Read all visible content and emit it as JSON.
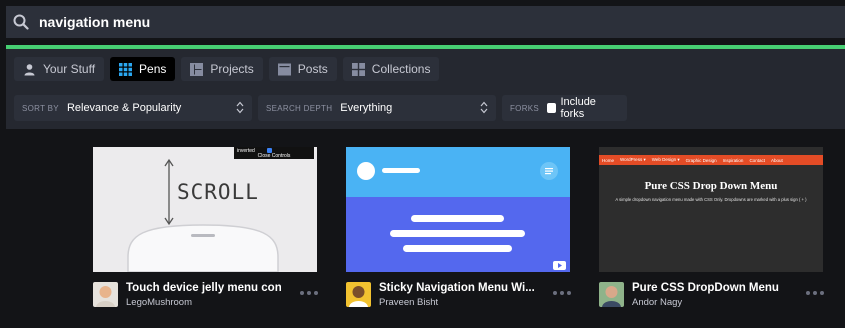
{
  "search": {
    "query": "navigation menu",
    "icon": "search-icon"
  },
  "colors": {
    "accent": "#47cf73",
    "panel": "#252830",
    "control": "#2c303a",
    "page": "#131417"
  },
  "tabs": [
    {
      "label": "Your Stuff",
      "icon": "user-icon",
      "active": false
    },
    {
      "label": "Pens",
      "icon": "pens-grid-icon",
      "active": true
    },
    {
      "label": "Projects",
      "icon": "projects-icon",
      "active": false
    },
    {
      "label": "Posts",
      "icon": "posts-icon",
      "active": false
    },
    {
      "label": "Collections",
      "icon": "collections-icon",
      "active": false
    }
  ],
  "filters": {
    "sort_label": "SORT BY",
    "sort_value": "Relevance & Popularity",
    "depth_label": "SEARCH DEPTH",
    "depth_value": "Everything",
    "forks_label": "FORKS",
    "forks_value": "Include forks"
  },
  "cards": [
    {
      "title": "Touch device jelly menu con...",
      "author": "LegoMushroom",
      "thumb": {
        "scroll_text": "SCROLL",
        "overlay_label": "inverted",
        "close_controls": "Close Controls"
      }
    },
    {
      "title": "Sticky Navigation Menu Wi...",
      "author": "Praveen Bisht"
    },
    {
      "title": "Pure CSS DropDown Menu",
      "author": "Andor Nagy",
      "thumb": {
        "nav_items": [
          "Home",
          "WordPress ▾",
          "Web Design ▾",
          "Graphic Design",
          "Inspiration",
          "Contact",
          "About"
        ],
        "heading": "Pure CSS Drop Down Menu",
        "description": "A simple dropdown navigation menu made with CSS Only. Dropdowns are marked with a plus sign ( + )"
      }
    }
  ]
}
